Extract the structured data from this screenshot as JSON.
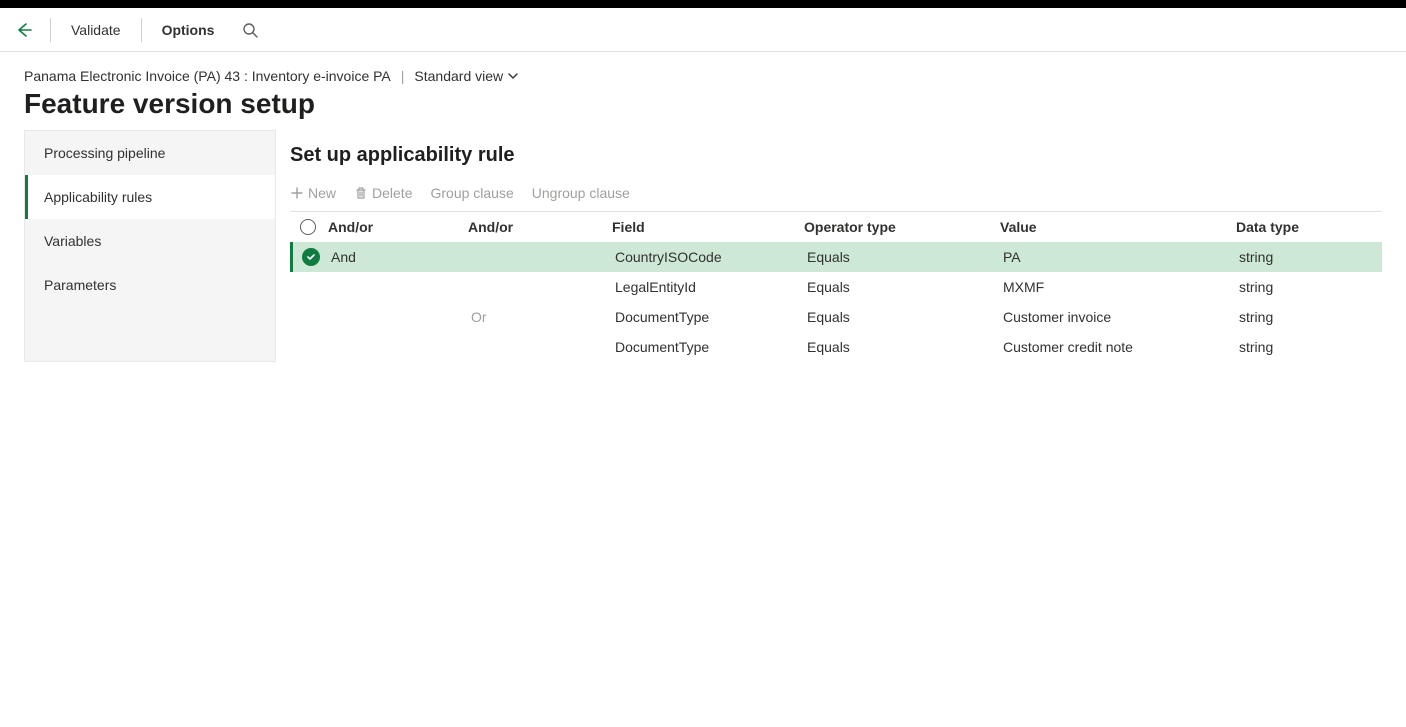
{
  "topbar": {
    "validate": "Validate",
    "options": "Options"
  },
  "header": {
    "breadcrumb": "Panama Electronic Invoice (PA) 43 : Inventory e-invoice PA",
    "view_label": "Standard view",
    "page_title": "Feature version setup"
  },
  "sidebar": {
    "items": [
      {
        "label": "Processing pipeline",
        "active": false
      },
      {
        "label": "Applicability rules",
        "active": true
      },
      {
        "label": "Variables",
        "active": false
      },
      {
        "label": "Parameters",
        "active": false
      }
    ]
  },
  "panel": {
    "title": "Set up applicability rule",
    "toolbar": {
      "new": "New",
      "delete": "Delete",
      "group": "Group clause",
      "ungroup": "Ungroup clause"
    },
    "columns": {
      "andor1": "And/or",
      "andor2": "And/or",
      "field": "Field",
      "op": "Operator type",
      "value": "Value",
      "type": "Data type"
    },
    "rows": [
      {
        "selected": true,
        "andor1": "And",
        "andor2": "",
        "field": "CountryISOCode",
        "op": "Equals",
        "value": "PA",
        "type": "string"
      },
      {
        "selected": false,
        "andor1": "",
        "andor2": "",
        "field": "LegalEntityId",
        "op": "Equals",
        "value": "MXMF",
        "type": "string"
      },
      {
        "selected": false,
        "andor1": "",
        "andor2": "Or",
        "field": "DocumentType",
        "op": "Equals",
        "value": "Customer invoice",
        "type": "string"
      },
      {
        "selected": false,
        "andor1": "",
        "andor2": "",
        "field": "DocumentType",
        "op": "Equals",
        "value": "Customer credit note",
        "type": "string"
      }
    ]
  }
}
